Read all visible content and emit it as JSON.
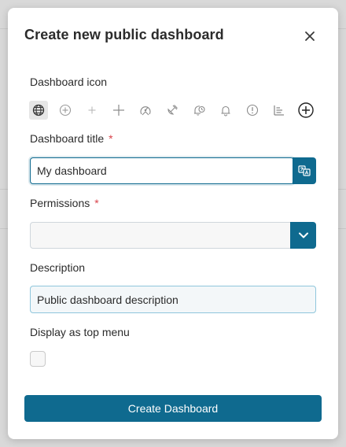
{
  "dialog": {
    "title": "Create new public dashboard",
    "close_icon": "close-icon"
  },
  "icon_picker": {
    "label": "Dashboard icon",
    "options": [
      {
        "icon": "globe-grid-icon",
        "selected": true
      },
      {
        "icon": "plus-circle-icon",
        "selected": false
      },
      {
        "icon": "plus-small-icon",
        "selected": false
      },
      {
        "icon": "plus-icon",
        "selected": false
      },
      {
        "icon": "compass-icon",
        "selected": false
      },
      {
        "icon": "satellite-icon",
        "selected": false
      },
      {
        "icon": "bell-clock-icon",
        "selected": false
      },
      {
        "icon": "bell-icon",
        "selected": false
      },
      {
        "icon": "alert-circle-icon",
        "selected": false
      },
      {
        "icon": "bar-chart-icon",
        "selected": false
      },
      {
        "icon": "plus-circle-bold-icon",
        "selected": false
      }
    ]
  },
  "title_field": {
    "label": "Dashboard title",
    "required_mark": "*",
    "value": "My dashboard",
    "translate_icon": "translate-icon"
  },
  "permissions_field": {
    "label": "Permissions",
    "required_mark": "*",
    "value": "",
    "caret_icon": "chevron-down-icon"
  },
  "description_field": {
    "label": "Description",
    "value": "Public dashboard description"
  },
  "top_menu": {
    "label": "Display as top menu",
    "checked": false
  },
  "submit": {
    "label": "Create Dashboard"
  },
  "colors": {
    "primary": "#0f6a8f",
    "required": "#d9434b"
  }
}
